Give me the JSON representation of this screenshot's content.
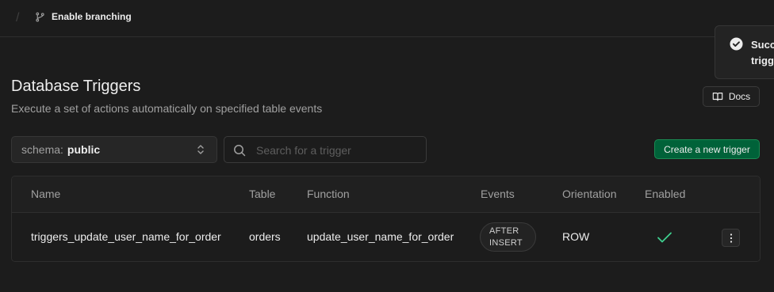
{
  "topbar": {
    "separator": "/",
    "branch_label": "Enable branching"
  },
  "toast": {
    "line1": "Succ",
    "line2": "trigg"
  },
  "page": {
    "title": "Database Triggers",
    "subtitle": "Execute a set of actions automatically on specified table events"
  },
  "toolbar": {
    "docs_label": "Docs",
    "schema_label": "schema:",
    "schema_value": "public",
    "search_placeholder": "Search for a trigger",
    "create_label": "Create a new trigger"
  },
  "table": {
    "columns": [
      "Name",
      "Table",
      "Function",
      "Events",
      "Orientation",
      "Enabled"
    ],
    "rows": [
      {
        "name": "triggers_update_user_name_for_order",
        "table": "orders",
        "function": "update_user_name_for_order",
        "events_line1": "AFTER",
        "events_line2": "INSERT",
        "orientation": "ROW",
        "enabled": true
      }
    ]
  },
  "colors": {
    "background": "#1c1c1c",
    "brand_green": "#006239",
    "check_green": "#3ecf8e"
  },
  "icons": {
    "branch": "git-branch-icon",
    "toast": "check-circle-icon",
    "docs": "book-open-icon",
    "schema": "chevrons-up-down-icon",
    "search": "search-icon",
    "enabled": "check-icon",
    "more": "more-vertical-icon"
  }
}
